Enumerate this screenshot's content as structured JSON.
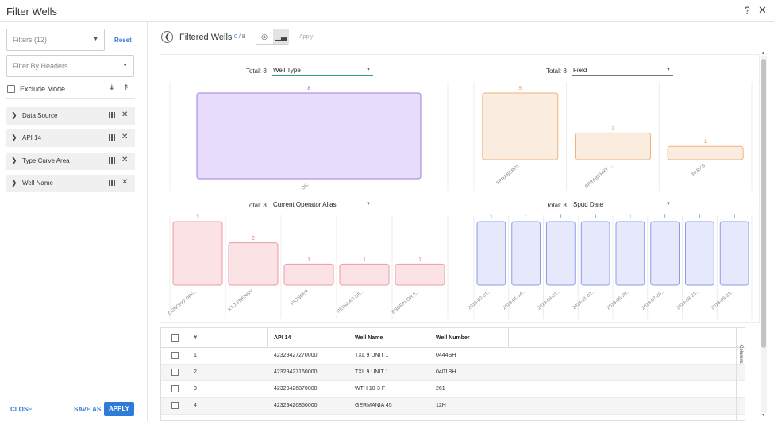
{
  "window": {
    "title": "Filter Wells",
    "help_icon": "help-icon",
    "close_icon": "close-icon"
  },
  "sidebar": {
    "filters_placeholder": "Filters (12)",
    "reset_label": "Reset",
    "headers_placeholder": "Filter By Headers",
    "exclude_label": "Exclude Mode",
    "items": [
      {
        "label": "Data Source"
      },
      {
        "label": "API 14"
      },
      {
        "label": "Type Curve Area"
      },
      {
        "label": "Well Name"
      }
    ],
    "close_label": "CLOSE",
    "save_as_label": "SAVE AS",
    "apply_label": "APPLY"
  },
  "toolbar": {
    "title": "Filtered Wells",
    "count_current": "0",
    "count_total": "/ 8",
    "map_icon": "globe-icon",
    "chart_icon": "bar-chart-icon",
    "apply_label": "Apply"
  },
  "charts": [
    {
      "total_label": "Total: 8",
      "select_value": "Well Type"
    },
    {
      "total_label": "Total: 8",
      "select_value": "Field"
    },
    {
      "total_label": "Total: 8",
      "select_value": "Current Operator Alias"
    },
    {
      "total_label": "Total: 8",
      "select_value": "Spud Date"
    }
  ],
  "chart_data": [
    {
      "type": "bar",
      "title": "Well Type",
      "categories": [
        "OIL"
      ],
      "values": [
        8
      ],
      "ylim": [
        0,
        8
      ],
      "color": "#9b7fe6",
      "fill": "#e8dcfb",
      "label_color": "#7f62d6"
    },
    {
      "type": "bar",
      "title": "Field",
      "categories": [
        "SPRABERRY",
        "SPRABERRY ...",
        "PARKS"
      ],
      "values": [
        5,
        2,
        1
      ],
      "ylim": [
        0,
        5
      ],
      "color": "#f0b27a",
      "fill": "#fbece0",
      "label_color": "#e89b4f"
    },
    {
      "type": "bar",
      "title": "Current Operator Alias",
      "categories": [
        "CONCHO OPE...",
        "XTO ENERGY",
        "PIONEER",
        "PERMIAN DE...",
        "ENDEAVOR E..."
      ],
      "values": [
        3,
        2,
        1,
        1,
        1
      ],
      "ylim": [
        0,
        3
      ],
      "color": "#ee9aa6",
      "fill": "#fbe2e5",
      "label_color": "#e0606f"
    },
    {
      "type": "bar",
      "title": "Spud Date",
      "categories": [
        "2018-02-01...",
        "2018-01-14...",
        "2018-09-01...",
        "2018-11-02...",
        "2018-05-28...",
        "2018-07-29...",
        "2018-08-23...",
        "2018-09-03..."
      ],
      "values": [
        1,
        1,
        1,
        1,
        1,
        1,
        1,
        1
      ],
      "ylim": [
        0,
        1
      ],
      "color": "#8e9be8",
      "fill": "#e6e9fb",
      "label_color": "#5b6fd9"
    }
  ],
  "table": {
    "headers": [
      "#",
      "API 14",
      "Well Name",
      "Well Number"
    ],
    "rows": [
      [
        "1",
        "42329427270000",
        "TXL 9 UNIT 1",
        "0444SH"
      ],
      [
        "2",
        "42329427160000",
        "TXL 9 UNIT 1",
        "0401BH"
      ],
      [
        "3",
        "42329426870000",
        "WTH 10-3 F",
        "261"
      ],
      [
        "4",
        "42329426860000",
        "GERMANIA 45",
        "12H"
      ]
    ],
    "columns_panel_label": "Columns"
  }
}
